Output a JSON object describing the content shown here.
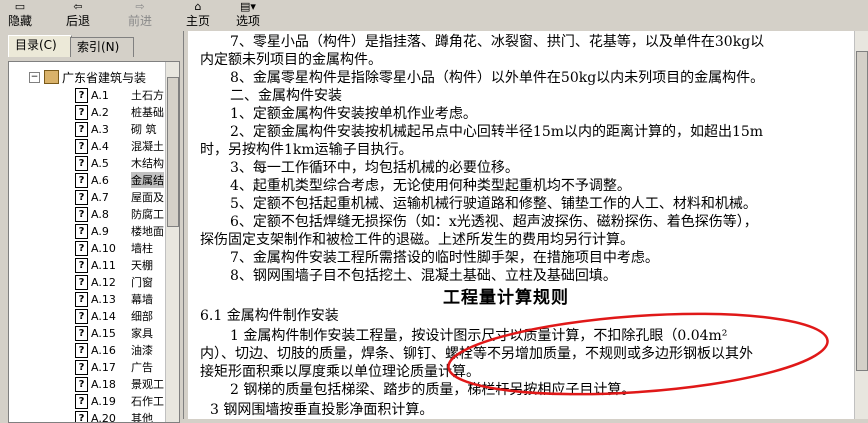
{
  "toolbar": {
    "hide": {
      "label": "隐藏",
      "icon": "hide-icon"
    },
    "back": {
      "label": "后退",
      "icon": "back-arrow-icon"
    },
    "forward": {
      "label": "前进",
      "icon": "forward-arrow-icon"
    },
    "home": {
      "label": "主页",
      "icon": "home-icon"
    },
    "options": {
      "label": "选项",
      "icon": "options-icon"
    }
  },
  "left_tabs": {
    "contents": "目录(C)",
    "index": "索引(N)"
  },
  "tree": {
    "root": "广东省建筑与装",
    "items": [
      {
        "code": "A.1",
        "label": "土石方"
      },
      {
        "code": "A.2",
        "label": "桩基础"
      },
      {
        "code": "A.3",
        "label": "砌 筑"
      },
      {
        "code": "A.4",
        "label": "混凝土"
      },
      {
        "code": "A.5",
        "label": "木结构"
      },
      {
        "code": "A.6",
        "label": "金属结"
      },
      {
        "code": "A.7",
        "label": "屋面及"
      },
      {
        "code": "A.8",
        "label": "防腐工"
      },
      {
        "code": "A.9",
        "label": "楼地面"
      },
      {
        "code": "A.10",
        "label": "墙柱"
      },
      {
        "code": "A.11",
        "label": "天棚"
      },
      {
        "code": "A.12",
        "label": "门窗"
      },
      {
        "code": "A.13",
        "label": "幕墙"
      },
      {
        "code": "A.14",
        "label": "细部"
      },
      {
        "code": "A.15",
        "label": "家具"
      },
      {
        "code": "A.16",
        "label": "油漆"
      },
      {
        "code": "A.17",
        "label": "广告"
      },
      {
        "code": "A.18",
        "label": "景观工"
      },
      {
        "code": "A.19",
        "label": "石作工"
      },
      {
        "code": "A.20",
        "label": "其他"
      }
    ]
  },
  "content": {
    "p1": "7、零星小品（构件）是指挂落、蹲角花、冰裂窗、拱门、花基等，以及单件在30kg以",
    "p1b": "内定额未列项目的金属构件。",
    "p2": "8、金属零星构件是指除零星小品（构件）以外单件在50kg以内未列项目的金属构件。",
    "p3": "二、金属构件安装",
    "p4": "1、定额金属构件安装按单机作业考虑。",
    "p5": "2、定额金属构件安装按机械起吊点中心回转半径15m以内的距离计算的，如超出15m",
    "p5b": "时，另按构件1km运输子目执行。",
    "p6": "3、每一工作循环中，均包括机械的必要位移。",
    "p7": "4、起重机类型综合考虑，无论使用何种类型起重机均不予调整。",
    "p8": "5、定额不包括起重机械、运输机械行驶道路和修整、铺垫工作的人工、材料和机械。",
    "p9": "6、定额不包括焊缝无损探伤（如：x光透视、超声波探伤、磁粉探伤、着色探伤等），",
    "p9b": "探伤固定支架制作和被检工件的退磁。上述所发生的费用均另行计算。",
    "p10": "7、金属构件安装工程所需搭设的临时性脚手架，在措施项目中考虑。",
    "p11": "8、钢网围墙子目不包括挖土、混凝土基础、立柱及基础回填。",
    "heading": "工程量计算规则",
    "r1": "6.1  金属构件制作安装",
    "r2": "1  金属构件制作安装工程量，按设计图示尺寸以质量计算，不扣除孔眼（0.04m²",
    "r2b": "内）、切边、切肢的质量，焊条、铆钉、螺栓等不另增加质量，不规则或多边形钢板以其外",
    "r2c": "接矩形面积乘以厚度乘以单位理论质量计算。",
    "r3": "2  钢梯的质量包括梯梁、踏步的质量，梯栏杆另按相应子目计算。",
    "r4": "3 钢网围墙按垂直投影净面积计算。"
  },
  "colors": {
    "annotation": "#e01818",
    "window_bg": "#d4d0c8"
  }
}
